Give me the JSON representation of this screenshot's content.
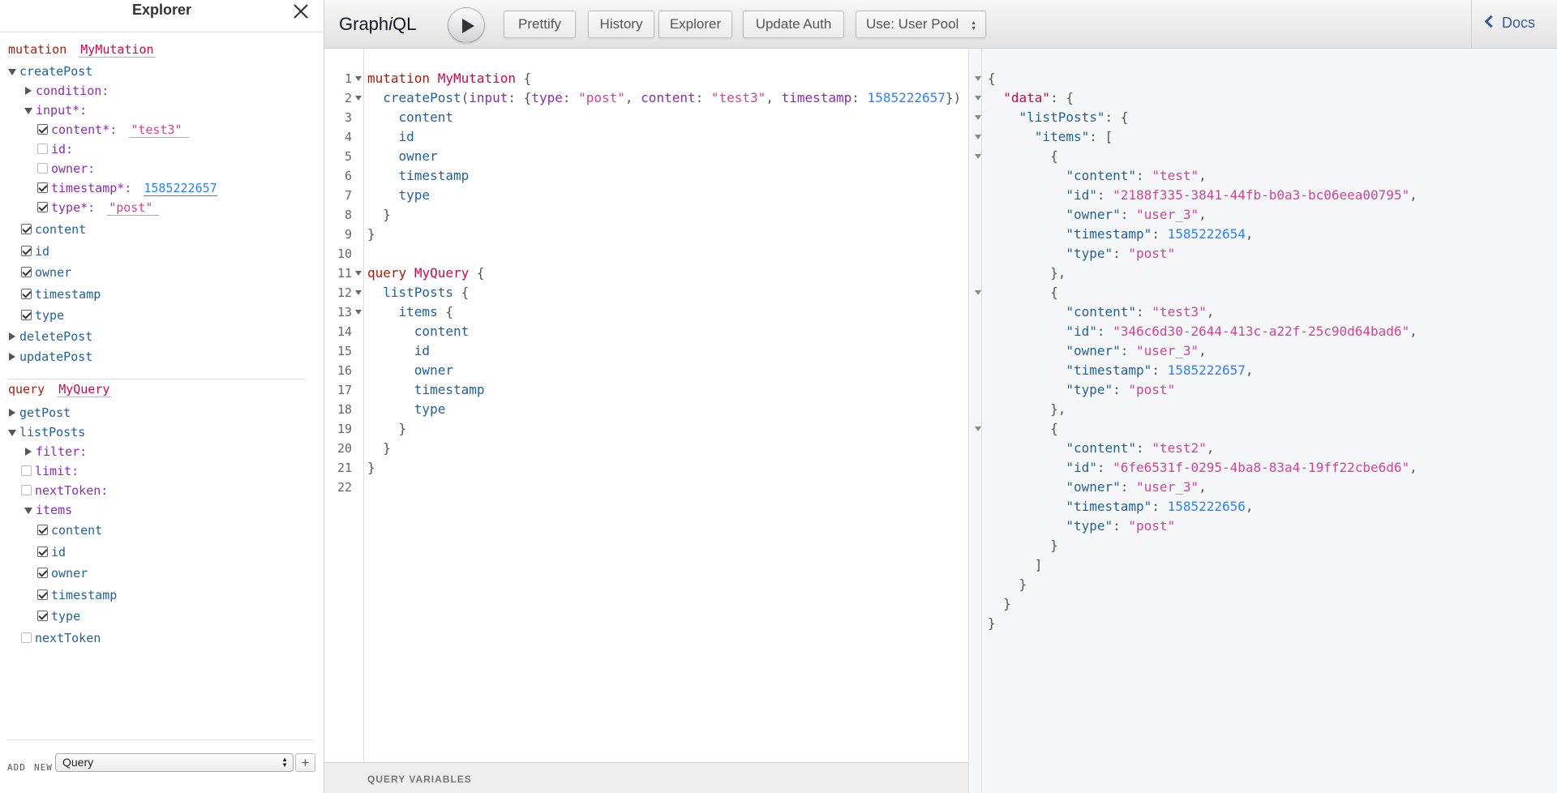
{
  "explorer": {
    "title": "Explorer",
    "mutation": {
      "keyword": "mutation",
      "name": "MyMutation",
      "createPost": "createPost",
      "condition": "condition:",
      "input": "input*:",
      "input_fields": [
        {
          "label": "content*:",
          "value": "\"test3\"",
          "kind": "string",
          "checked": true
        },
        {
          "label": "id:",
          "checked": false
        },
        {
          "label": "owner:",
          "checked": false
        },
        {
          "label": "timestamp*:",
          "value": "1585222657",
          "kind": "number",
          "checked": true
        },
        {
          "label": "type*:",
          "value": "\"post\"",
          "kind": "string",
          "checked": true
        }
      ],
      "fields": [
        "content",
        "id",
        "owner",
        "timestamp",
        "type"
      ],
      "deletePost": "deletePost",
      "updatePost": "updatePost"
    },
    "query": {
      "keyword": "query",
      "name": "MyQuery",
      "getPost": "getPost",
      "listPosts": "listPosts",
      "filter": "filter:",
      "limit": "limit:",
      "nextToken_arg": "nextToken:",
      "items": "items",
      "item_fields": [
        "content",
        "id",
        "owner",
        "timestamp",
        "type"
      ],
      "nextToken": "nextToken"
    },
    "footer": {
      "add": "ADD",
      "new": "NEW",
      "select_value": "Query",
      "plus": "+"
    }
  },
  "toolbar": {
    "brand_prefix": "Graph",
    "brand_italic": "i",
    "brand_suffix": "QL",
    "prettify": "Prettify",
    "history": "History",
    "explorer": "Explorer",
    "update_auth": "Update Auth",
    "user_pool": "Use: User Pool",
    "docs": "Docs"
  },
  "editor": {
    "line_numbers": [
      "1",
      "2",
      "3",
      "4",
      "5",
      "6",
      "7",
      "8",
      "9",
      "10",
      "11",
      "12",
      "13",
      "14",
      "15",
      "16",
      "17",
      "18",
      "19",
      "20",
      "21",
      "22"
    ],
    "mutation_kw": "mutation",
    "mutation_name": "MyMutation",
    "create_post": "createPost",
    "input_attr": "input",
    "type_attr": "type",
    "type_val": "\"post\"",
    "content_attr": "content",
    "content_val": "\"test3\"",
    "timestamp_attr": "timestamp",
    "timestamp_val": "1585222657",
    "fields": [
      "content",
      "id",
      "owner",
      "timestamp",
      "type"
    ],
    "query_kw": "query",
    "query_name": "MyQuery",
    "list_posts": "listPosts",
    "items": "items",
    "query_fields": [
      "content",
      "id",
      "owner",
      "timestamp",
      "type"
    ],
    "variables_label": "QUERY VARIABLES"
  },
  "result": {
    "data_key": "\"data\"",
    "list_key": "\"listPosts\"",
    "items_key": "\"items\"",
    "items": [
      {
        "content": "\"test\"",
        "id": "\"2188f335-3841-44fb-b0a3-bc06eea00795\"",
        "owner": "\"user_3\"",
        "timestamp": "1585222654",
        "type": "\"post\""
      },
      {
        "content": "\"test3\"",
        "id": "\"346c6d30-2644-413c-a22f-25c90d64bad6\"",
        "owner": "\"user_3\"",
        "timestamp": "1585222657",
        "type": "\"post\""
      },
      {
        "content": "\"test2\"",
        "id": "\"6fe6531f-0295-4ba8-83a4-19ff22cbe6d6\"",
        "owner": "\"user_3\"",
        "timestamp": "1585222656",
        "type": "\"post\""
      }
    ],
    "keys": {
      "content": "\"content\"",
      "id": "\"id\"",
      "owner": "\"owner\"",
      "timestamp": "\"timestamp\"",
      "type": "\"type\""
    }
  },
  "colors": {
    "keyword": "#b11a04",
    "def": "#d2054e",
    "property": "#1f61a0",
    "attribute": "#8b2bb9",
    "string": "#d64292",
    "number": "#2882f9",
    "docs_link": "#3b5998"
  },
  "icons": {
    "close": "close-icon",
    "run": "play-icon",
    "docs": "chevron-left-icon",
    "select": "updown-arrows-icon"
  }
}
